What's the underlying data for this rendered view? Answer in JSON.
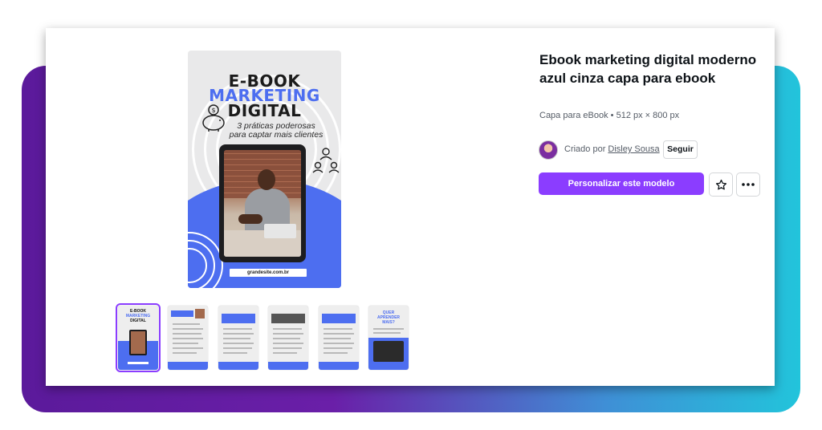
{
  "template": {
    "title": "Ebook marketing digital moderno azul cinza capa para ebook",
    "meta": "Capa para eBook • 512 px × 800 px",
    "created_by_label": "Criado por",
    "author": "Disley Sousa",
    "follow_label": "Seguir",
    "customize_label": "Personalizar este modelo"
  },
  "preview": {
    "title_line1": "E-BOOK",
    "title_line2": "MARKETING",
    "title_line3": "DIGITAL",
    "subtitle_line1": "3 práticas poderosas",
    "subtitle_line2": "para captar mais clientes",
    "url": "grandesite.com.br"
  },
  "colors": {
    "accent": "#8b3dff",
    "cover_blue": "#4d6ef0",
    "gradient_start": "#5b1a9b",
    "gradient_end": "#22c4db"
  },
  "icons": [
    "piggy-bank-icon",
    "people-network-icon",
    "star-icon",
    "more-icon"
  ]
}
